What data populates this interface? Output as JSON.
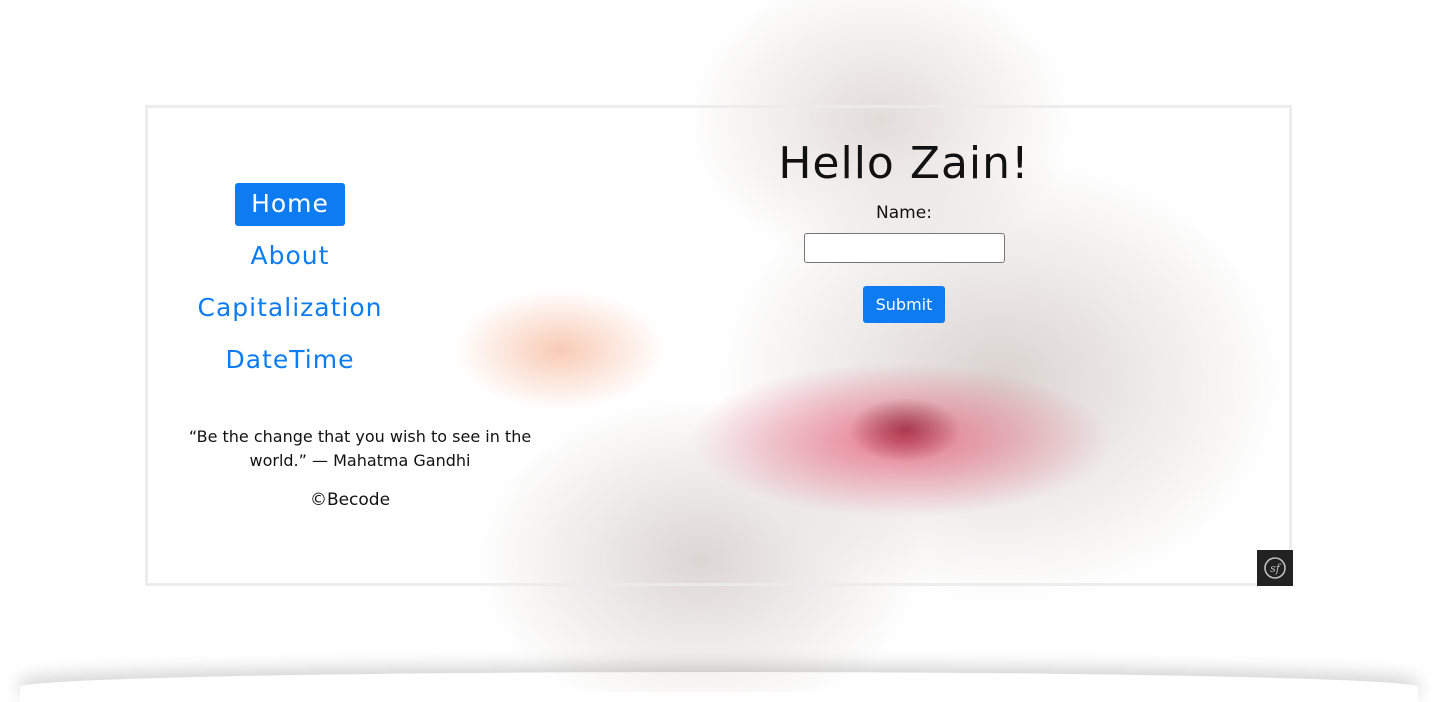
{
  "nav": {
    "items": [
      {
        "label": "Home",
        "active": true
      },
      {
        "label": "About",
        "active": false
      },
      {
        "label": "Capitalization",
        "active": false
      },
      {
        "label": "DateTime",
        "active": false
      }
    ]
  },
  "footer": {
    "quote": "“Be the change that you wish to see in the world.” — Mahatma Gandhi",
    "copyright": "©Becode"
  },
  "main": {
    "heading": "Hello Zain!",
    "form": {
      "name_label": "Name:",
      "name_value": "",
      "submit_label": "Submit"
    }
  },
  "toolbar": {
    "icon": "symfony-icon"
  },
  "colors": {
    "accent": "#0d7cf2",
    "text": "#111111",
    "toolbar_bg": "#222222"
  }
}
